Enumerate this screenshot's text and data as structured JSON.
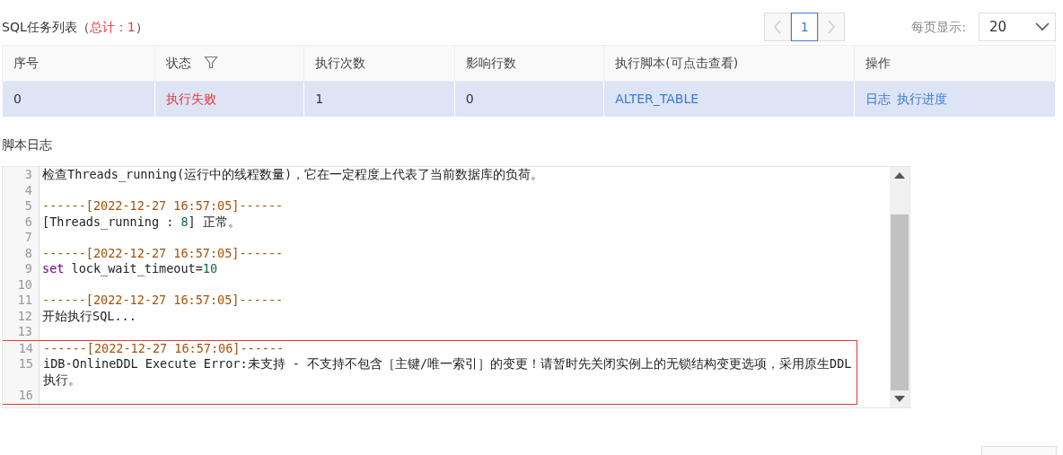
{
  "list_title": [
    {
      "kind": "plain",
      "text": "SQL任务列表（"
    },
    {
      "kind": "count",
      "text": "总计：1"
    },
    {
      "kind": "plain",
      "text": "）"
    }
  ],
  "pagination": {
    "prev": {
      "disabled": true
    },
    "pages": [
      {
        "label": "1",
        "selected": true
      }
    ],
    "next": {
      "disabled": true
    }
  },
  "page_size": {
    "label": "每页显示:",
    "value": "20"
  },
  "table": {
    "columns": [
      {
        "label": "序号",
        "filter": false
      },
      {
        "label": "状态",
        "filter": true
      },
      {
        "label": "执行次数",
        "filter": false
      },
      {
        "label": "影响行数",
        "filter": false
      },
      {
        "label": "执行脚本(可点击查看)",
        "filter": false
      },
      {
        "label": "操作",
        "filter": false
      }
    ],
    "rows": [
      {
        "selected": true,
        "cells": [
          {
            "kind": "plain",
            "text": "0"
          },
          {
            "kind": "status",
            "text": "执行失败"
          },
          {
            "kind": "plain",
            "text": "1"
          },
          {
            "kind": "plain",
            "text": "0"
          },
          {
            "kind": "link",
            "text": "ALTER_TABLE"
          },
          {
            "kind": "actions",
            "links": [
              "日志",
              "执行进度"
            ]
          }
        ]
      }
    ]
  },
  "log": {
    "title": "脚本日志",
    "lines": [
      {
        "number": "3",
        "highlighted": false,
        "segments": [
          {
            "kind": "text",
            "text": "检查Threads_running(运行中的线程数量)，它在一定程度上代表了当前数据库的负荷。"
          }
        ]
      },
      {
        "number": "4",
        "highlighted": false
      },
      {
        "number": "5",
        "highlighted": false,
        "segments": [
          {
            "kind": "separator",
            "text": "------[2022-12-27 16:57:05]------"
          }
        ]
      },
      {
        "number": "6",
        "highlighted": false,
        "segments": [
          {
            "kind": "text",
            "text": "[Threads_running : "
          },
          {
            "kind": "number",
            "text": "8"
          },
          {
            "kind": "text",
            "text": "] 正常。"
          }
        ]
      },
      {
        "number": "7",
        "highlighted": false
      },
      {
        "number": "8",
        "highlighted": false,
        "segments": [
          {
            "kind": "separator",
            "text": "------[2022-12-27 16:57:05]------"
          }
        ]
      },
      {
        "number": "9",
        "highlighted": false,
        "segments": [
          {
            "kind": "keyword",
            "text": "set"
          },
          {
            "kind": "text",
            "text": " lock_wait_timeout="
          },
          {
            "kind": "number",
            "text": "10"
          }
        ]
      },
      {
        "number": "10",
        "highlighted": false
      },
      {
        "number": "11",
        "highlighted": false,
        "segments": [
          {
            "kind": "separator",
            "text": "------[2022-12-27 16:57:05]------"
          }
        ]
      },
      {
        "number": "12",
        "highlighted": false,
        "segments": [
          {
            "kind": "text",
            "text": "开始执行SQL..."
          }
        ]
      },
      {
        "number": "13",
        "highlighted": false
      },
      {
        "number": "14",
        "highlighted": true,
        "segments": [
          {
            "kind": "separator",
            "text": "------[2022-12-27 16:57:06]------"
          }
        ]
      },
      {
        "number": "15",
        "highlighted": true,
        "segments": [
          {
            "kind": "text",
            "text": "iDB-OnlineDDL Execute Error:未支持 - 不支持不包含［主键/唯一索引］的变更！请暂时先关闭实例上的无锁结构变更选项，采用原生DDL执行。"
          }
        ]
      },
      {
        "number": "16",
        "highlighted": true
      }
    ]
  }
}
